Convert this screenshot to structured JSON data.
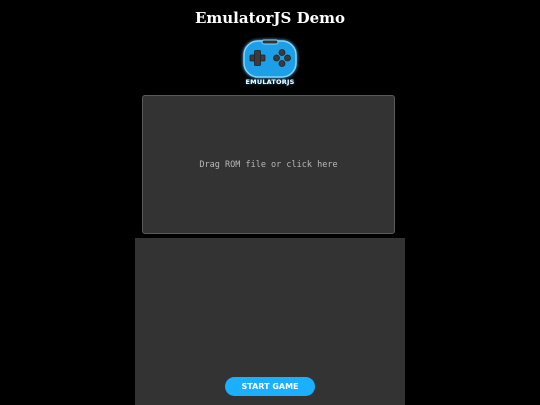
{
  "page": {
    "title": "EmulatorJS Demo"
  },
  "logo": {
    "icon": "gamepad-icon",
    "text": "EMULATORJS",
    "accent": "#1aafff"
  },
  "dropzone": {
    "label": "Drag ROM file or click here"
  },
  "game": {
    "start_label": "START GAME"
  },
  "colors": {
    "background": "#000000",
    "panel": "#333333",
    "accent": "#1aafff"
  }
}
